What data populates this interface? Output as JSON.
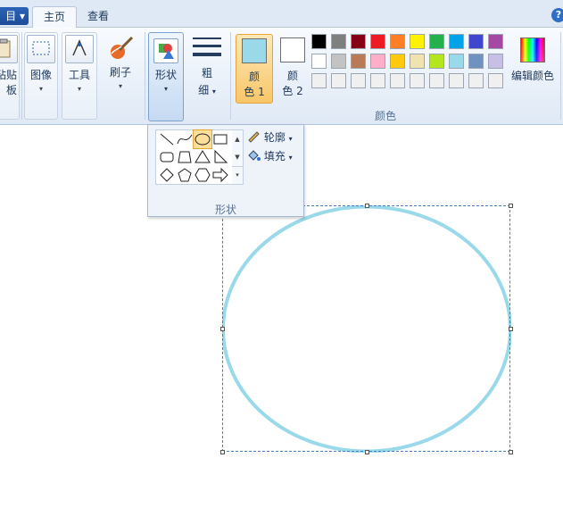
{
  "tabs": {
    "file_label": "目 ▾",
    "home": "主页",
    "view": "查看"
  },
  "help_label": "?",
  "ribbon": {
    "clipboard": "粘贴板",
    "image": "图像",
    "tools": "工具",
    "brushes": "刷子",
    "shapes": "形状",
    "size_line1": "粗",
    "size_line2": "细",
    "dropdown_arrow": "▾",
    "color1_line1": "颜",
    "color1_line2": "色 1",
    "color2_line1": "颜",
    "color2_line2": "色 2",
    "edit_colors": "编辑颜色",
    "colors_group": "颜色"
  },
  "colors": {
    "color1": "#99d9ea",
    "color2": "#ffffff",
    "palette_row1": [
      "#000000",
      "#7f7f7f",
      "#880015",
      "#ed1c24",
      "#ff7f27",
      "#fff200",
      "#22b14c",
      "#00a2e8",
      "#3f48cc",
      "#a349a4"
    ],
    "palette_row2": [
      "#ffffff",
      "#c3c3c3",
      "#b97a57",
      "#ffaec9",
      "#ffc90e",
      "#efe4b0",
      "#b5e61d",
      "#99d9ea",
      "#7092be",
      "#c8bfe7"
    ],
    "palette_row3": [
      "#f0f0f0",
      "#f0f0f0",
      "#f0f0f0",
      "#f0f0f0",
      "#f0f0f0",
      "#f0f0f0",
      "#f0f0f0",
      "#f0f0f0",
      "#f0f0f0",
      "#f0f0f0"
    ]
  },
  "shape_popup": {
    "outline_label": "轮廓",
    "fill_label": "填充",
    "group_label": "形状",
    "shapes": [
      "line-icon",
      "curve-icon",
      "oval-icon",
      "rectangle-icon",
      "rounded-rectangle-icon",
      "polygon-icon",
      "triangle-icon",
      "right-triangle-icon",
      "diamond-icon",
      "pentagon-icon",
      "hexagon-icon",
      "right-arrow-icon"
    ],
    "selected_shape": "oval-icon"
  },
  "canvas": {
    "shape": "oval",
    "stroke_color": "#99d9ea"
  }
}
